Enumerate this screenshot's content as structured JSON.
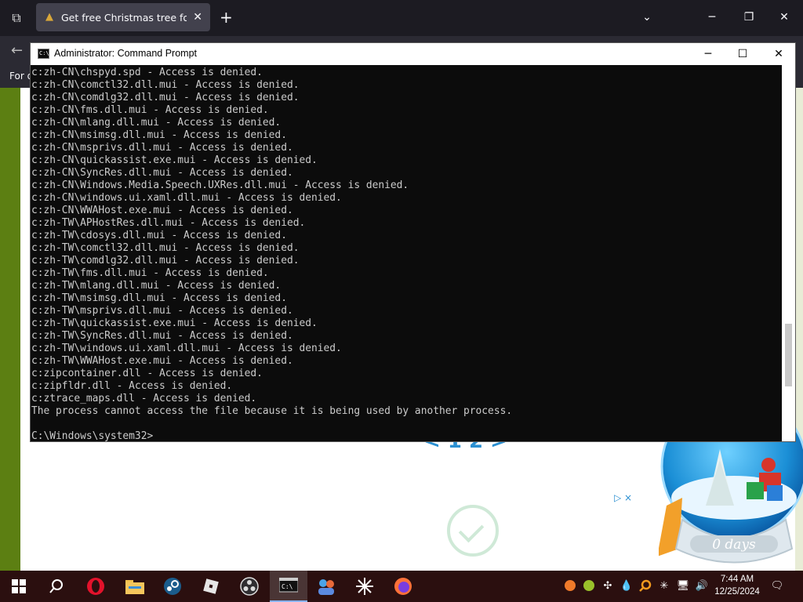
{
  "browser": {
    "tab_title": "Get free Christmas tree for your",
    "bookmark_text": "For q",
    "pager_text": "< 1 2 >",
    "ad_marks": "▷ ×"
  },
  "snowglobe": {
    "counter_text": "0 days"
  },
  "cmd": {
    "title": "Administrator: Command Prompt",
    "icon_text": "C:\\",
    "lines": [
      "c:zh-CN\\chspyd.spd - Access is denied.",
      "c:zh-CN\\comctl32.dll.mui - Access is denied.",
      "c:zh-CN\\comdlg32.dll.mui - Access is denied.",
      "c:zh-CN\\fms.dll.mui - Access is denied.",
      "c:zh-CN\\mlang.dll.mui - Access is denied.",
      "c:zh-CN\\msimsg.dll.mui - Access is denied.",
      "c:zh-CN\\msprivs.dll.mui - Access is denied.",
      "c:zh-CN\\quickassist.exe.mui - Access is denied.",
      "c:zh-CN\\SyncRes.dll.mui - Access is denied.",
      "c:zh-CN\\Windows.Media.Speech.UXRes.dll.mui - Access is denied.",
      "c:zh-CN\\windows.ui.xaml.dll.mui - Access is denied.",
      "c:zh-CN\\WWAHost.exe.mui - Access is denied.",
      "c:zh-TW\\APHostRes.dll.mui - Access is denied.",
      "c:zh-TW\\cdosys.dll.mui - Access is denied.",
      "c:zh-TW\\comctl32.dll.mui - Access is denied.",
      "c:zh-TW\\comdlg32.dll.mui - Access is denied.",
      "c:zh-TW\\fms.dll.mui - Access is denied.",
      "c:zh-TW\\mlang.dll.mui - Access is denied.",
      "c:zh-TW\\msimsg.dll.mui - Access is denied.",
      "c:zh-TW\\msprivs.dll.mui - Access is denied.",
      "c:zh-TW\\quickassist.exe.mui - Access is denied.",
      "c:zh-TW\\SyncRes.dll.mui - Access is denied.",
      "c:zh-TW\\windows.ui.xaml.dll.mui - Access is denied.",
      "c:zh-TW\\WWAHost.exe.mui - Access is denied.",
      "c:zipcontainer.dll - Access is denied.",
      "c:zipfldr.dll - Access is denied.",
      "c:ztrace_maps.dll - Access is denied.",
      "The process cannot access the file because it is being used by another process.",
      "",
      "C:\\Windows\\system32>"
    ]
  },
  "taskbar": {
    "apps": [
      "windows-start",
      "search",
      "opera",
      "file-explorer",
      "steam",
      "roblox",
      "obs",
      "command-prompt",
      "app-people",
      "app-star",
      "firefox"
    ],
    "active_app": "command-prompt",
    "clock_time": "7:44 AM",
    "clock_date": "12/25/2024"
  },
  "colors": {
    "cmd_bg": "#0c0c0c",
    "cmd_text": "#cccccc",
    "taskbar_bg": "#2b0f0f",
    "page_green": "#5c7f12"
  }
}
